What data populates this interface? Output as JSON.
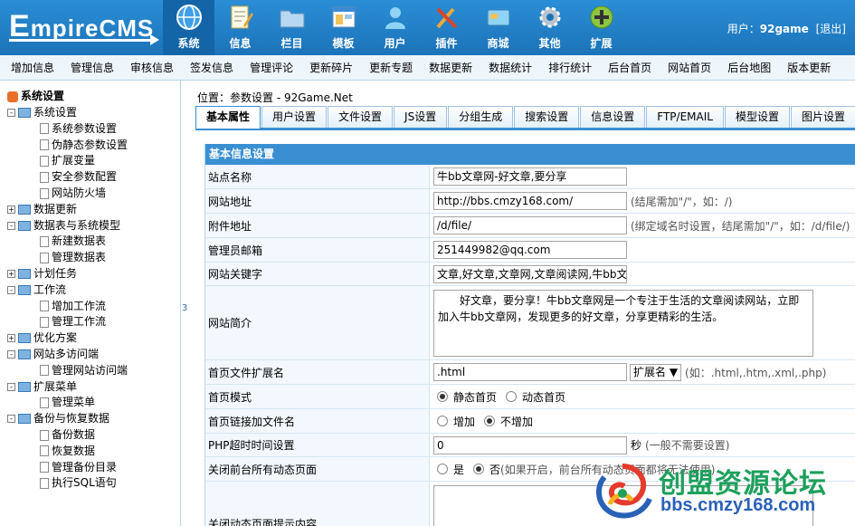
{
  "logo": {
    "text_big": "E",
    "text_rest": "mpireCMS"
  },
  "mainnav": [
    {
      "label": "系统",
      "icon": "globe-icon"
    },
    {
      "label": "信息",
      "icon": "document-edit-icon"
    },
    {
      "label": "栏目",
      "icon": "folder-icon"
    },
    {
      "label": "模板",
      "icon": "template-window-icon"
    },
    {
      "label": "用户",
      "icon": "user-icon"
    },
    {
      "label": "插件",
      "icon": "tools-icon"
    },
    {
      "label": "商城",
      "icon": "card-icon"
    },
    {
      "label": "其他",
      "icon": "gear-icon"
    },
    {
      "label": "扩展",
      "icon": "plus-circle-icon"
    }
  ],
  "user": {
    "prefix": "用户：",
    "name": "92game",
    "logout": "[退出]"
  },
  "subnav": [
    "增加信息",
    "管理信息",
    "审核信息",
    "签发信息",
    "管理评论",
    "更新碎片",
    "更新专题",
    "数据更新",
    "数据统计",
    "排行统计",
    "后台首页",
    "网站首页",
    "后台地图",
    "版本更新"
  ],
  "tree": {
    "root": "系统设置",
    "nodes": [
      {
        "label": "系统设置",
        "level": 0,
        "type": "folder",
        "toggle": "-"
      },
      {
        "label": "系统参数设置",
        "level": 1,
        "type": "page"
      },
      {
        "label": "伪静态参数设置",
        "level": 1,
        "type": "page"
      },
      {
        "label": "扩展变量",
        "level": 1,
        "type": "page"
      },
      {
        "label": "安全参数配置",
        "level": 1,
        "type": "page"
      },
      {
        "label": "网站防火墙",
        "level": 1,
        "type": "page"
      },
      {
        "label": "数据更新",
        "level": 0,
        "type": "folder",
        "toggle": "+"
      },
      {
        "label": "数据表与系统模型",
        "level": 0,
        "type": "folder",
        "toggle": "-"
      },
      {
        "label": "新建数据表",
        "level": 1,
        "type": "page"
      },
      {
        "label": "管理数据表",
        "level": 1,
        "type": "page"
      },
      {
        "label": "计划任务",
        "level": 0,
        "type": "folder",
        "toggle": "+"
      },
      {
        "label": "工作流",
        "level": 0,
        "type": "folder",
        "toggle": "-"
      },
      {
        "label": "增加工作流",
        "level": 1,
        "type": "page"
      },
      {
        "label": "管理工作流",
        "level": 1,
        "type": "page"
      },
      {
        "label": "优化方案",
        "level": 0,
        "type": "folder",
        "toggle": "+"
      },
      {
        "label": "网站多访问端",
        "level": 0,
        "type": "folder",
        "toggle": "-"
      },
      {
        "label": "管理网站访问端",
        "level": 1,
        "type": "page"
      },
      {
        "label": "扩展菜单",
        "level": 0,
        "type": "folder",
        "toggle": "-"
      },
      {
        "label": "管理菜单",
        "level": 1,
        "type": "page"
      },
      {
        "label": "备份与恢复数据",
        "level": 0,
        "type": "folder",
        "toggle": "-"
      },
      {
        "label": "备份数据",
        "level": 1,
        "type": "page"
      },
      {
        "label": "恢复数据",
        "level": 1,
        "type": "page"
      },
      {
        "label": "管理备份目录",
        "level": 1,
        "type": "page"
      },
      {
        "label": "执行SQL语句",
        "level": 1,
        "type": "page"
      }
    ]
  },
  "splitter_text": "3",
  "breadcrumb": "位置：参数设置 - 92Game.Net",
  "tabs": [
    "基本属性",
    "用户设置",
    "文件设置",
    "JS设置",
    "分组生成",
    "搜索设置",
    "信息设置",
    "FTP/EMAIL",
    "模型设置",
    "图片设置"
  ],
  "section_title": "基本信息设置",
  "fields": {
    "sitename": {
      "label": "站点名称",
      "value": "牛bb文章网-好文章,要分享"
    },
    "siteurl": {
      "label": "网站地址",
      "value": "http://bbs.cmzy168.com/",
      "hint": "(结尾需加\"/\"，如：/)"
    },
    "fileurl": {
      "label": "附件地址",
      "value": "/d/file/",
      "hint": "(绑定域名时设置，结尾需加\"/\"，如：/d/file/)"
    },
    "email": {
      "label": "管理员邮箱",
      "value": "251449982@qq.com"
    },
    "keywords": {
      "label": "网站关键字",
      "value": "文章,好文章,文章网,文章阅读网,牛bb文"
    },
    "intro": {
      "label": "网站简介",
      "value": "　　好文章，要分享！牛bb文章网是一个专注于生活的文章阅读网站，立即加入牛bb文章网，发现更多的好文章，分享更精彩的生活。"
    },
    "indexext": {
      "label": "首页文件扩展名",
      "value": ".html",
      "select": "扩展名 ▼",
      "hint": "(如：.html,.htm,.xml,.php)"
    },
    "indexmode": {
      "label": "首页模式",
      "opt1": "静态首页",
      "opt2": "动态首页"
    },
    "indexlink": {
      "label": "首页链接加文件名",
      "opt1": "增加",
      "opt2": "不增加"
    },
    "phptimeout": {
      "label": "PHP超时时间设置",
      "value": "0",
      "unit": "秒",
      "hint": "(一般不需要设置)"
    },
    "closedynamic": {
      "label": "关闭前台所有动态页面",
      "opt1": "是",
      "opt2": "否",
      "hint": "(如果开启，前台所有动态页面都将无法使用)"
    },
    "closetip": {
      "label": "关闭动态页面提示内容"
    }
  },
  "watermark": {
    "line1": "创盟资源论坛",
    "line2": "bbs.cmzy168.com"
  },
  "colors": {
    "header": "#1c73b8",
    "accent": "#3a8fd3",
    "watermark_green": "#1da05c",
    "watermark_blue": "#2a61b7"
  }
}
